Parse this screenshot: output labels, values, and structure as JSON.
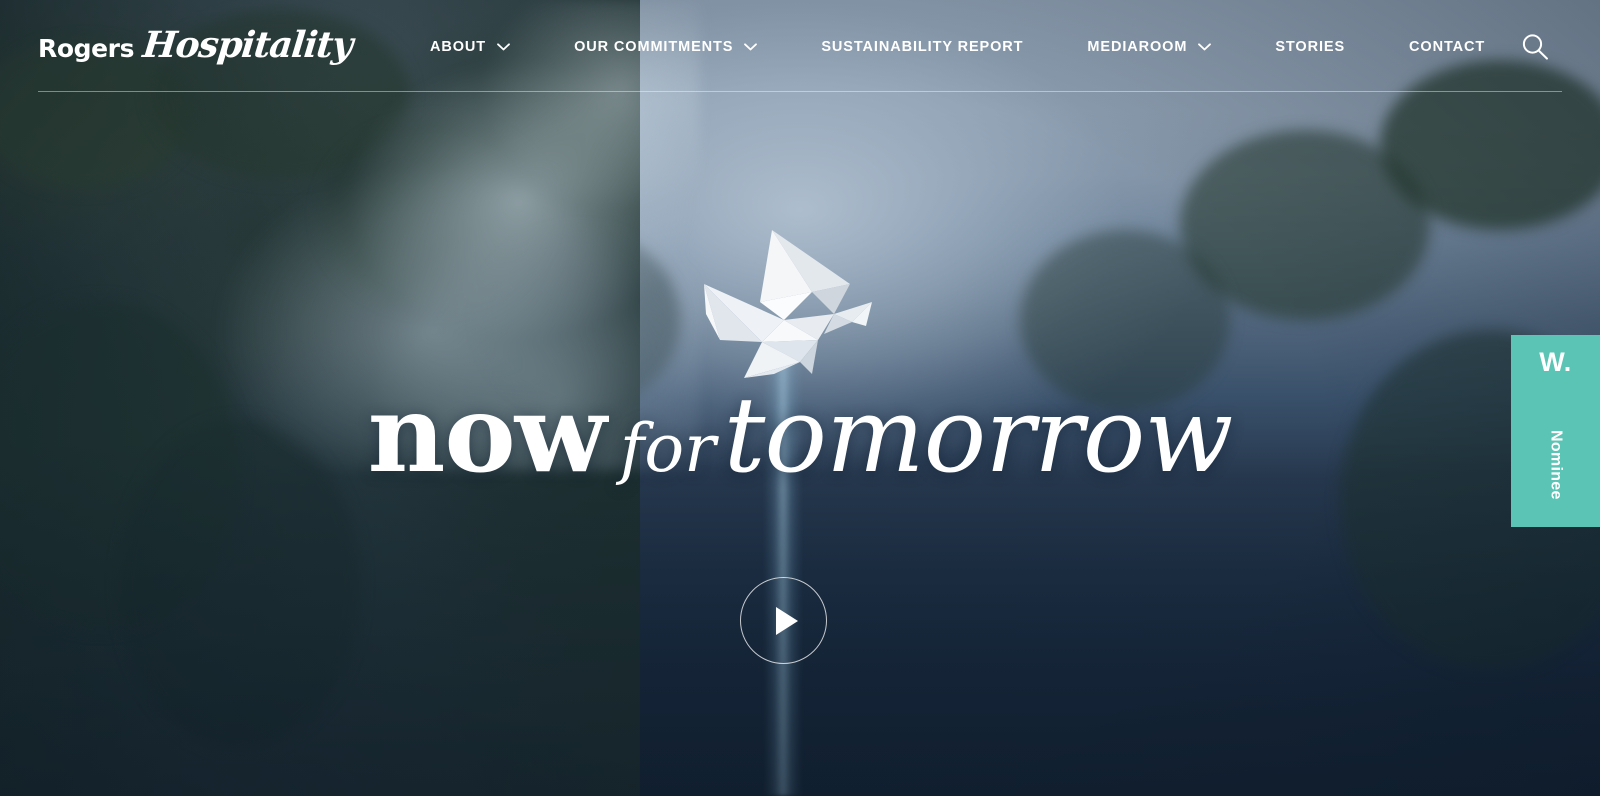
{
  "site": {
    "logo_primary": "Rogers",
    "logo_secondary": "Hospitality"
  },
  "header": {
    "nav_items": [
      {
        "label": "ABOUT",
        "has_dropdown": true
      },
      {
        "label": "OUR COMMITMENTS",
        "has_dropdown": true
      },
      {
        "label": "SUSTAINABILITY REPORT",
        "has_dropdown": false
      },
      {
        "label": "MEDIAROOM",
        "has_dropdown": true
      },
      {
        "label": "STORIES",
        "has_dropdown": false
      },
      {
        "label": "CONTACT",
        "has_dropdown": false
      }
    ],
    "search_icon": "search-icon"
  },
  "hero": {
    "dove_icon": "origami-dove-icon",
    "headline_word_1": "now",
    "headline_word_2": "for",
    "headline_word_3": "tomorrow",
    "play_icon": "play-triangle-icon"
  },
  "award_badge": {
    "mark": "W.",
    "label": "Nominee",
    "color": "#5bc4b4"
  },
  "colors": {
    "header_overlay": "#72869a",
    "hero_dark": "#17283b",
    "accent_teal": "#5bc4b4",
    "text_on_dark": "#ffffff"
  }
}
